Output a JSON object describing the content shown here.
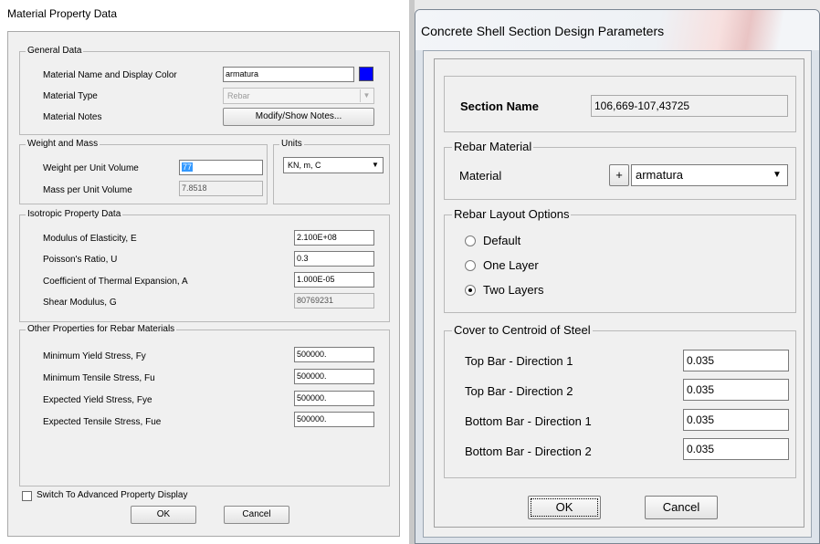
{
  "material_dialog": {
    "title": "Material Property Data",
    "general": {
      "group_title": "General Data",
      "name_label": "Material Name and Display Color",
      "name_value": "armatura",
      "display_color": "#0000ff",
      "type_label": "Material Type",
      "type_value": "Rebar",
      "notes_label": "Material Notes",
      "notes_button": "Modify/Show Notes..."
    },
    "weight": {
      "group_title": "Weight and Mass",
      "weight_label": "Weight per Unit Volume",
      "weight_value": "77",
      "mass_label": "Mass per Unit Volume",
      "mass_value": "7.8518"
    },
    "units": {
      "group_title": "Units",
      "value": "KN, m, C"
    },
    "isotropic": {
      "group_title": "Isotropic Property Data",
      "rows": [
        {
          "label": "Modulus of Elasticity,  E",
          "value": "2.100E+08"
        },
        {
          "label": "Poisson's Ratio,  U",
          "value": "0.3"
        },
        {
          "label": "Coefficient of Thermal Expansion,  A",
          "value": "1.000E-05"
        },
        {
          "label": "Shear Modulus,  G",
          "value": "80769231"
        }
      ]
    },
    "rebar": {
      "group_title": "Other Properties for Rebar Materials",
      "rows": [
        {
          "label": "Minimum Yield Stress, Fy",
          "value": "500000."
        },
        {
          "label": "Minimum Tensile Stress, Fu",
          "value": "500000."
        },
        {
          "label": "Expected Yield Stress, Fye",
          "value": "500000."
        },
        {
          "label": "Expected Tensile Stress, Fue",
          "value": "500000."
        }
      ]
    },
    "advanced_checkbox_label": "Switch To Advanced Property Display",
    "ok_label": "OK",
    "cancel_label": "Cancel"
  },
  "shell_dialog": {
    "title": "Concrete Shell Section Design Parameters",
    "section_name_label": "Section Name",
    "section_name_value": "106,669-107,43725",
    "rebar_material": {
      "group_title": "Rebar Material",
      "material_label": "Material",
      "plus_label": "+",
      "material_value": "armatura"
    },
    "layout": {
      "group_title": "Rebar Layout Options",
      "options": [
        "Default",
        "One Layer",
        "Two Layers"
      ],
      "selected": "Two Layers"
    },
    "cover": {
      "group_title": "Cover to Centroid of Steel",
      "rows": [
        {
          "label": "Top Bar  -  Direction 1",
          "value": "0.035"
        },
        {
          "label": "Top Bar  -  Direction 2",
          "value": "0.035"
        },
        {
          "label": "Bottom Bar  -  Direction 1",
          "value": "0.035"
        },
        {
          "label": "Bottom Bar  -  Direction 2",
          "value": "0.035"
        }
      ]
    },
    "ok_label": "OK",
    "cancel_label": "Cancel"
  }
}
